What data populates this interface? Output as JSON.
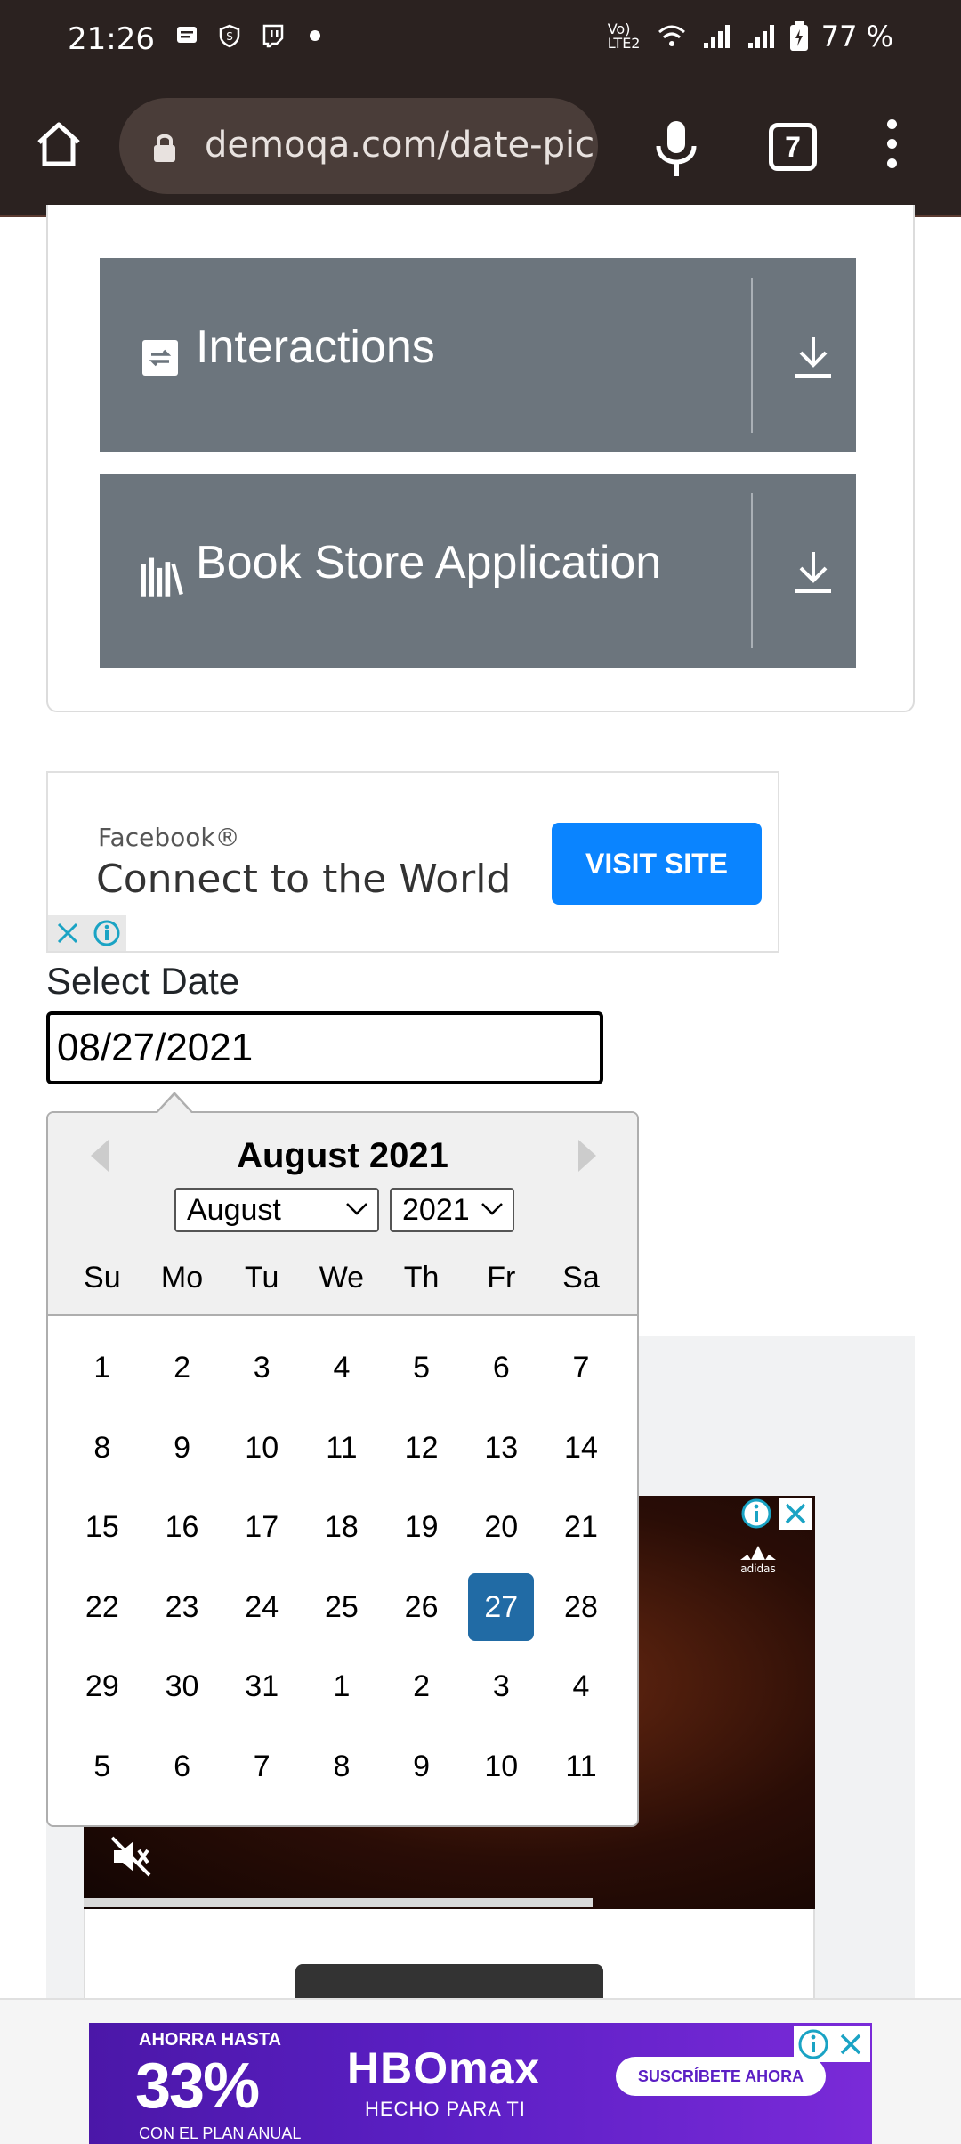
{
  "status_bar": {
    "time": "21:26",
    "battery": "77 %",
    "network": "Vo) LTE2"
  },
  "browser": {
    "url": "demoqa.com/date-pic",
    "tab_count": "7"
  },
  "menu_groups": [
    {
      "label": "Interactions",
      "icon": "interactions-icon"
    },
    {
      "label": "Book Store Application",
      "icon": "book-store-icon"
    }
  ],
  "fb_ad": {
    "brand": "Facebook®",
    "headline": "Connect to the World",
    "cta": "VISIT SITE"
  },
  "date_picker": {
    "label": "Select Date",
    "value": "08/27/2021"
  },
  "calendar": {
    "title": "August 2021",
    "month_select": "August",
    "year_select": "2021",
    "weekdays": [
      "Su",
      "Mo",
      "Tu",
      "We",
      "Th",
      "Fr",
      "Sa"
    ],
    "weeks": [
      [
        "1",
        "2",
        "3",
        "4",
        "5",
        "6",
        "7"
      ],
      [
        "8",
        "9",
        "10",
        "11",
        "12",
        "13",
        "14"
      ],
      [
        "15",
        "16",
        "17",
        "18",
        "19",
        "20",
        "21"
      ],
      [
        "22",
        "23",
        "24",
        "25",
        "26",
        "27",
        "28"
      ],
      [
        "29",
        "30",
        "31",
        "1",
        "2",
        "3",
        "4"
      ],
      [
        "5",
        "6",
        "7",
        "8",
        "9",
        "10",
        "11"
      ]
    ],
    "selected_day": "27"
  },
  "video_ad": {
    "brand_logo": "adidas"
  },
  "bottom_ad": {
    "promo_small": "AHORRA HASTA",
    "promo_big": "33%",
    "promo_sub": "CON EL PLAN ANUAL",
    "logo": "HBOmax",
    "tagline": "HECHO PARA TI",
    "cta": "SUSCRÍBETE AHORA"
  },
  "colors": {
    "browser_chrome": "#2b2220",
    "group_bg": "#6c757d",
    "selected_day": "#216ba5",
    "fb_cta": "#0a84ff"
  }
}
